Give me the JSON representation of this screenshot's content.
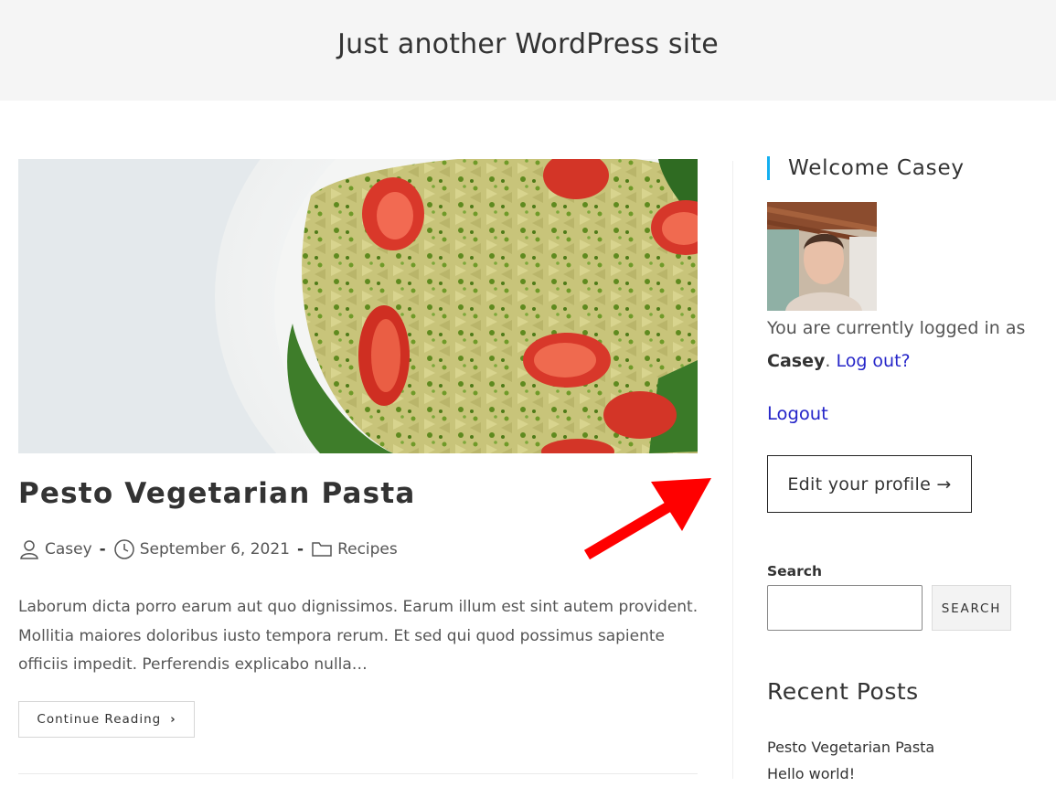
{
  "header": {
    "tagline": "Just another WordPress site"
  },
  "post": {
    "title": "Pesto Vegetarian Pasta",
    "author": "Casey",
    "date": "September 6, 2021",
    "category": "Recipes",
    "excerpt": "Laborum dicta porro earum aut quo dignissimos. Earum illum est sint autem provident. Mollitia maiores doloribus iusto tempora rerum. Et sed qui quod possimus sapiente officiis impedit. Perferendis explicabo nulla…",
    "continue_label": "Continue Reading",
    "separator": "-"
  },
  "sidebar": {
    "welcome_title": "Welcome Casey",
    "logged_in_prefix": "You are currently logged in as",
    "username": "Casey",
    "period": ".",
    "logout_question": "Log out?",
    "logout_link": "Logout",
    "edit_profile": "Edit your profile →",
    "search_label": "Search",
    "search_value": "",
    "search_button": "SEARCH",
    "recent_posts_title": "Recent Posts",
    "recent_posts": [
      "Pesto Vegetarian Pasta",
      "Hello world!"
    ]
  },
  "icons": {
    "author": "user-icon",
    "date": "clock-icon",
    "category": "folder-icon",
    "continue": "chevron-right-icon",
    "annotation": "red-arrow-icon"
  },
  "colors": {
    "header_bg": "#f5f5f5",
    "accent": "#13aff0",
    "link": "#2626c9",
    "annotation_arrow": "#ff0000"
  }
}
